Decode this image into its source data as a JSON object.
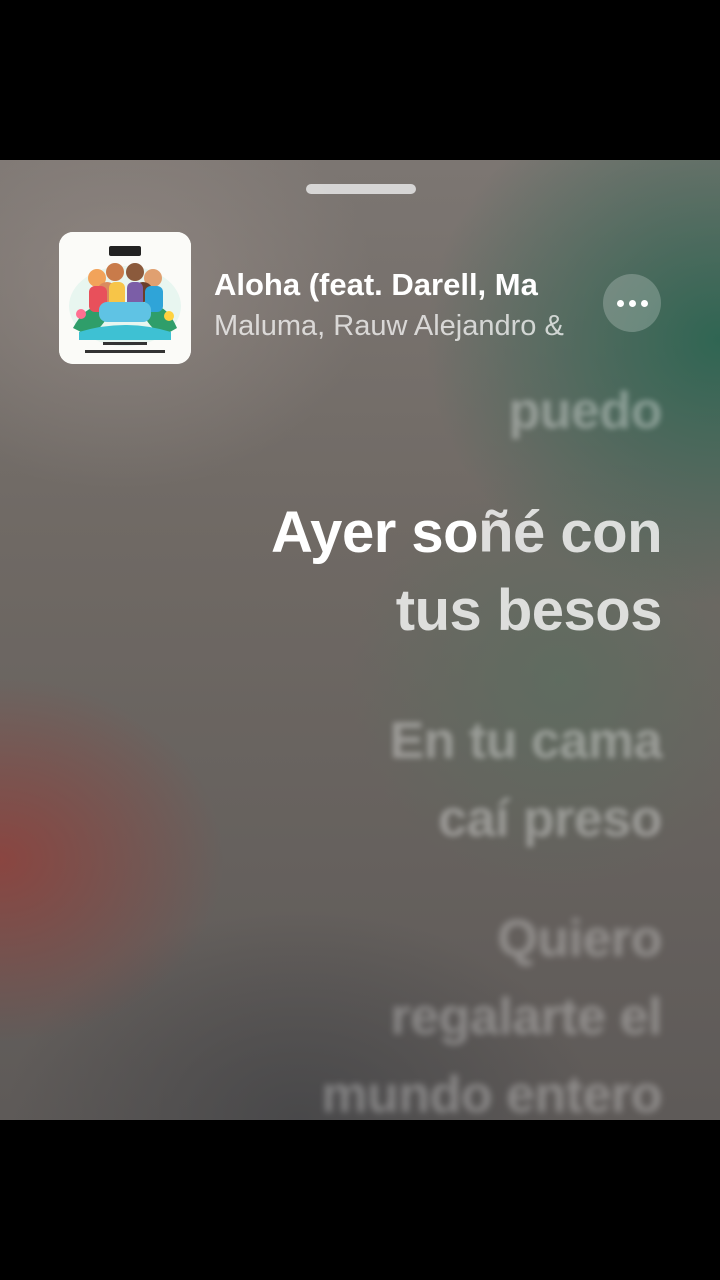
{
  "now_playing": {
    "title": "Aloha (feat. Darell, Ma",
    "artist": "Maluma, Rauw Alejandro &",
    "artwork": {
      "name": "album-artwork",
      "logo_text": "Aloha",
      "credits_line_1": "DJ LUIAN & MAMBO KINGZ",
      "credits_line_2": "MALUMA × BESO × RAUW ALEJANDRO × DARELL"
    },
    "more_icon": "ellipsis-icon"
  },
  "lyrics": {
    "previous": "puedo",
    "current_line_1_sung": "Ayer so",
    "current_line_1_rest": "ñé con",
    "current_line_2": "tus besos",
    "next_line_1": "En tu cama",
    "next_line_2": "caí preso",
    "after_line_1": "Quiero",
    "after_line_2": "regalarte el",
    "after_line_3": "mundo entero"
  }
}
